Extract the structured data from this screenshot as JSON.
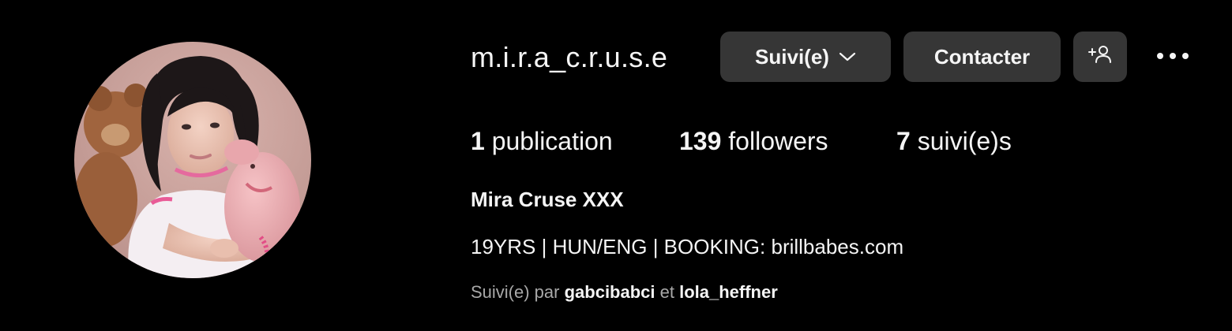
{
  "profile": {
    "username": "m.i.r.a_c.r.u.s.e",
    "full_name": "Mira Cruse XXX",
    "bio": "19YRS | HUN/ENG | BOOKING: brillbabes.com"
  },
  "actions": {
    "follow_label": "Suivi(e)",
    "follow_icon": "chevron-down-icon",
    "contact_label": "Contacter",
    "suggest_icon": "add-person-icon",
    "more_icon": "more-horizontal-icon"
  },
  "stats": {
    "posts_count": "1",
    "posts_label": " publication",
    "followers_count": "139",
    "followers_label": " followers",
    "following_count": "7",
    "following_label": " suivi(e)s"
  },
  "followed_by": {
    "prefix": "Suivi(e) par ",
    "user1": "gabcibabci",
    "separator": " et ",
    "user2": "lola_heffner"
  },
  "colors": {
    "background": "#000000",
    "button_bg": "#363636",
    "text_primary": "#f5f5f5",
    "text_secondary": "#a8a8a8"
  }
}
